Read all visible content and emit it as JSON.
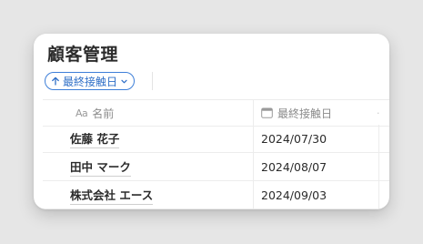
{
  "page": {
    "title": "顧客管理"
  },
  "sort": {
    "label": "最終接触日",
    "direction_icon": "arrow-up-icon",
    "dropdown_icon": "chevron-down-icon",
    "accent_color": "#3e7fd8"
  },
  "table": {
    "columns": [
      {
        "label": "名前",
        "icon": "text-type-icon",
        "icon_text": "Aa"
      },
      {
        "label": "最終接触日",
        "icon": "calendar-icon"
      }
    ],
    "rows": [
      {
        "name": "佐藤 花子",
        "last_contact": "2024/07/30"
      },
      {
        "name": "田中 マーク",
        "last_contact": "2024/08/07"
      },
      {
        "name": "株式会社 エース",
        "last_contact": "2024/09/03"
      }
    ]
  }
}
